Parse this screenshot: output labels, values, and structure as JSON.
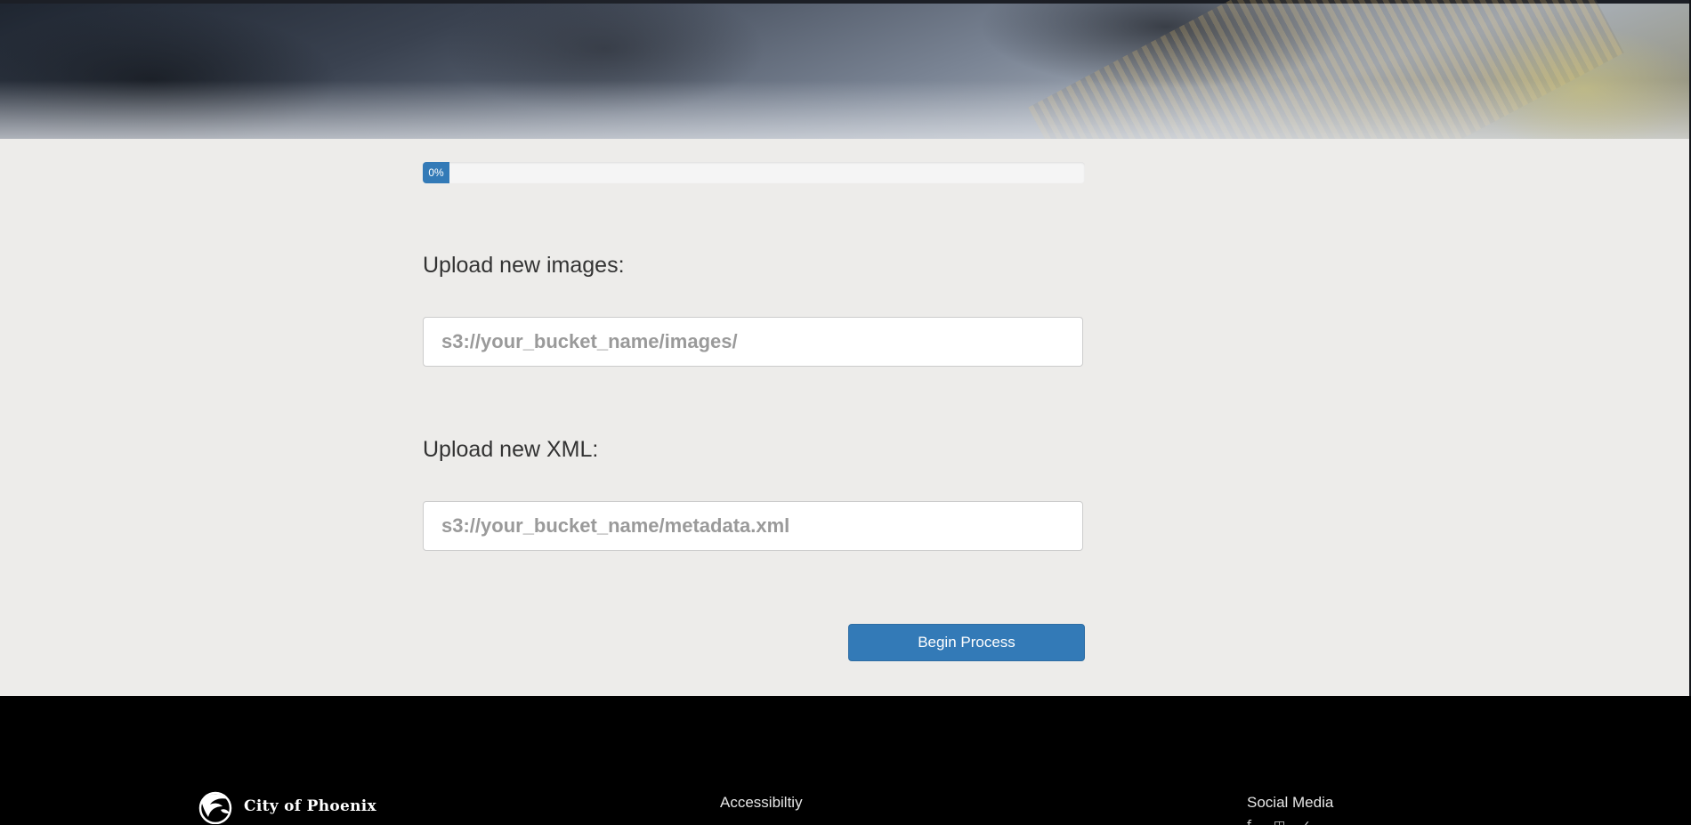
{
  "progress": {
    "value_percent": 0,
    "label": "0%",
    "color": "#337ab7"
  },
  "images_upload": {
    "label": "Upload new images:",
    "placeholder": "s3://your_bucket_name/images/"
  },
  "xml_upload": {
    "label": "Upload new XML:",
    "placeholder": "s3://your_bucket_name/metadata.xml"
  },
  "begin_button": {
    "label": "Begin Process"
  },
  "footer": {
    "logo_text": "City of Phoenix",
    "accessibility_heading": "Accessibiltiy",
    "social_heading": "Social Media",
    "social_icons": [
      "facebook-icon",
      "instagram-icon",
      "twitter-icon"
    ]
  }
}
